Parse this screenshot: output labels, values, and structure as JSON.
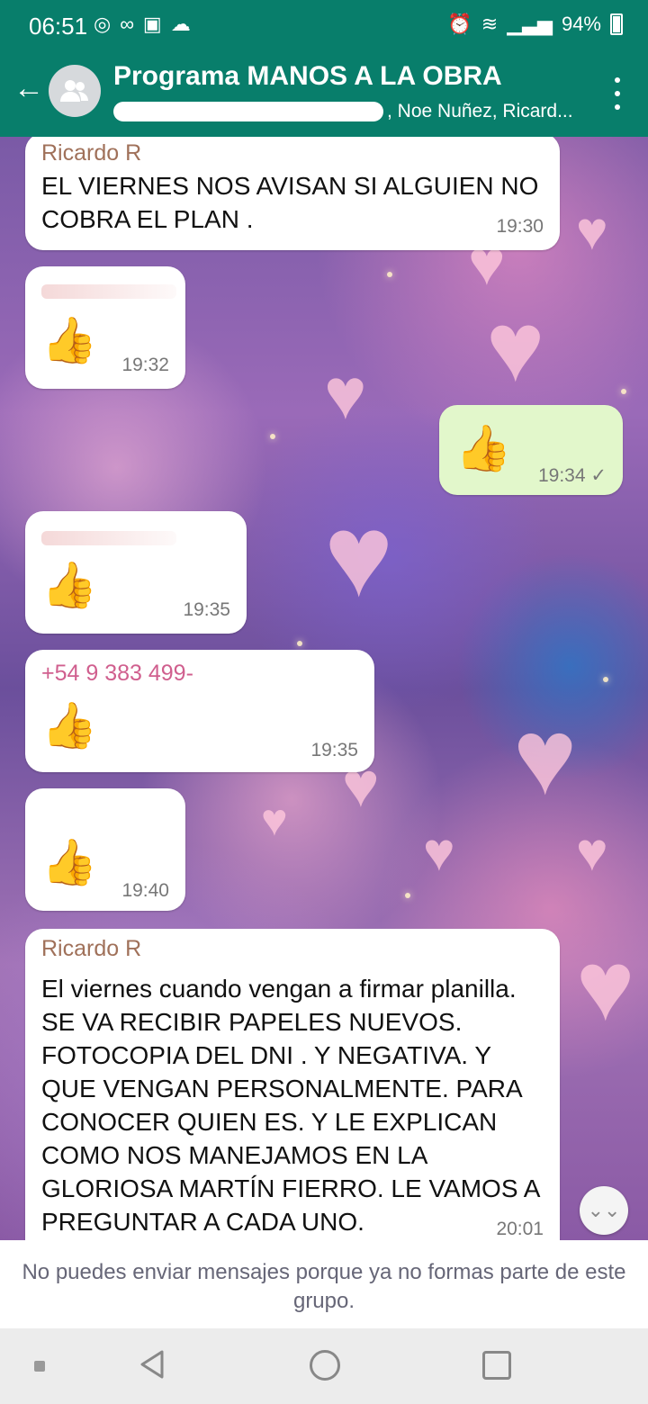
{
  "status_bar": {
    "time": "06:51",
    "battery": "94%"
  },
  "header": {
    "title": "Programa MANOS A LA OBRA",
    "members": ", Noe Nuñez, Ricard..."
  },
  "messages": [
    {
      "sender": "Ricardo R",
      "text": "EL VIERNES NOS AVISAN SI ALGUIEN NO COBRA EL PLAN .",
      "time": "19:30"
    },
    {
      "emoji": "👍",
      "time": "19:32"
    },
    {
      "emoji": "👍",
      "time": "19:34",
      "check": "✓"
    },
    {
      "emoji": "👍",
      "time": "19:35"
    },
    {
      "sender": "+54 9 383 499-",
      "emoji": "👍",
      "time": "19:35"
    },
    {
      "emoji": "👍",
      "time": "19:40"
    },
    {
      "sender": "Ricardo R",
      "text": "El viernes cuando vengan a firmar planilla. SE VA RECIBIR PAPELES NUEVOS. FOTOCOPIA DEL DNI . Y NEGATIVA. Y QUE VENGAN PERSONALMENTE.  PARA CONOCER QUIEN ES. Y LE EXPLICAN COMO NOS MANEJAMOS EN LA GLORIOSA MARTÍN FIERRO. LE VAMOS A PREGUNTAR A CADA UNO.",
      "time": "20:01"
    }
  ],
  "footer": {
    "notice": "No puedes enviar mensajes porque ya no formas parte de este grupo."
  },
  "icons": {
    "back": "arrow-left-icon",
    "menu": "more-vert-icon",
    "scroll_down": "double-chevron-down-icon"
  },
  "colors": {
    "header": "#087e6b",
    "outgoing_bubble": "#e2f7cb",
    "incoming_bubble": "#ffffff",
    "sender_name": "#a0715a",
    "sender_phone": "#d05f8e"
  }
}
